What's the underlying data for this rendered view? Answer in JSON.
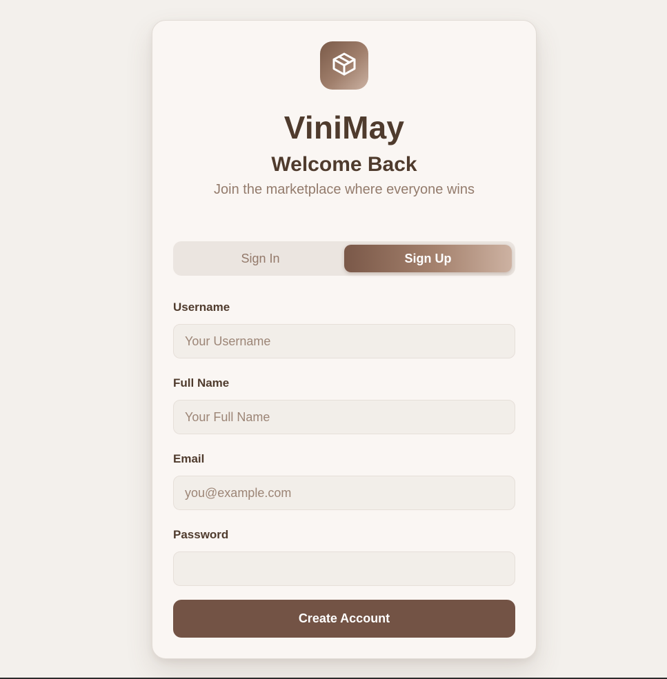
{
  "brand": {
    "name": "ViniMay",
    "logo_icon": "package-box-icon"
  },
  "header": {
    "title": "Welcome Back",
    "subtitle": "Join the marketplace where everyone wins"
  },
  "tabs": [
    {
      "label": "Sign In",
      "active": false
    },
    {
      "label": "Sign Up",
      "active": true
    }
  ],
  "form": {
    "username": {
      "label": "Username",
      "value": "",
      "placeholder": "Your Username"
    },
    "full_name": {
      "label": "Full Name",
      "value": "",
      "placeholder": "Your Full Name"
    },
    "email": {
      "label": "Email",
      "value": "",
      "placeholder": "you@example.com"
    },
    "password": {
      "label": "Password",
      "value": "",
      "placeholder": ""
    },
    "submit_label": "Create Account"
  },
  "colors": {
    "accent": "#735345",
    "text": "#4f3b2d",
    "muted": "#937b6c",
    "background": "#f3f0ec",
    "card": "#faf6f3"
  }
}
